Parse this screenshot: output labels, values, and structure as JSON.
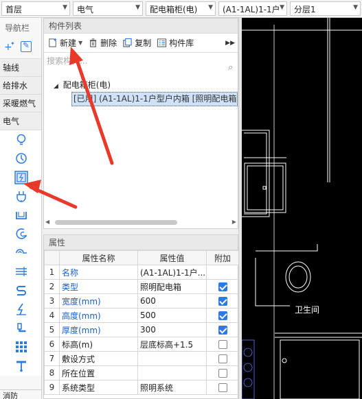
{
  "topbar": {
    "floor": "首层",
    "discipline": "电气",
    "category": "配电箱柜(电)",
    "component": "(A1-1AL)1-1户",
    "layer": "分层1"
  },
  "nav": {
    "title": "导航栏",
    "categories": [
      "轴线",
      "给排水",
      "采暖燃气",
      "电气"
    ],
    "bottom_category": "消防"
  },
  "list_panel": {
    "title": "构件列表",
    "toolbar": {
      "new": "新建",
      "delete": "删除",
      "copy": "复制",
      "library": "构件库"
    },
    "search_placeholder": "搜索构件...",
    "tree_root": "配电箱柜(电)",
    "tree_child": "[已用] (A1-1AL)1-1户型户内箱 [照明配电箱 (",
    "expand_glyph": "◢"
  },
  "props_panel": {
    "title": "属性",
    "headers": {
      "num": "",
      "name": "属性名称",
      "value": "属性值",
      "add": "附加"
    },
    "rows": [
      {
        "num": "1",
        "name": "名称",
        "value": "(A1-1AL)1-1户...",
        "blue": true,
        "check": null
      },
      {
        "num": "2",
        "name": "类型",
        "value": "照明配电箱",
        "blue": true,
        "check": true
      },
      {
        "num": "3",
        "name": "宽度(mm)",
        "value": "600",
        "blue": true,
        "check": true
      },
      {
        "num": "4",
        "name": "高度(mm)",
        "value": "500",
        "blue": true,
        "check": true
      },
      {
        "num": "5",
        "name": "厚度(mm)",
        "value": "300",
        "blue": true,
        "check": true
      },
      {
        "num": "6",
        "name": "标高(m)",
        "value": "层底标高+1.5",
        "blue": false,
        "check": false
      },
      {
        "num": "7",
        "name": "敷设方式",
        "value": "",
        "blue": false,
        "check": false
      },
      {
        "num": "8",
        "name": "所在位置",
        "value": "",
        "blue": false,
        "check": false
      },
      {
        "num": "9",
        "name": "系统类型",
        "value": "照明系统",
        "blue": false,
        "check": false
      }
    ]
  },
  "cad": {
    "label": "卫生间"
  },
  "colors": {
    "accent": "#2d7be0",
    "annotation_arrow": "#e8392b",
    "cad_line": "#ffffff",
    "cad_bg": "#000000"
  }
}
